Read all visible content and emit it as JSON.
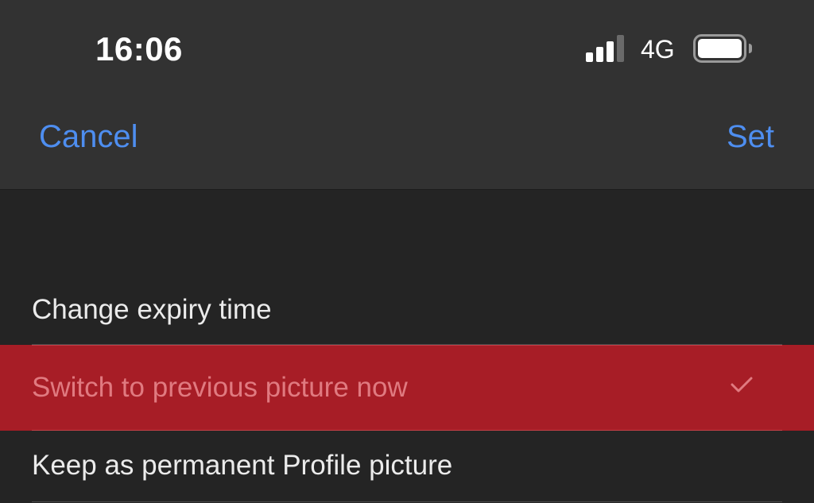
{
  "status_bar": {
    "time": "16:06",
    "network": "4G",
    "signal_icon": "signal-bars-icon",
    "battery_icon": "battery-icon"
  },
  "nav": {
    "cancel_label": "Cancel",
    "set_label": "Set"
  },
  "options": [
    {
      "label": "Change expiry time",
      "selected": false
    },
    {
      "label": "Switch to previous picture now",
      "selected": true,
      "icon": "checkmark-icon"
    },
    {
      "label": "Keep as permanent Profile picture",
      "selected": false
    }
  ],
  "colors": {
    "accent": "#4e8ef0",
    "highlight": "#a71d26",
    "highlight_text": "#e07a80",
    "background": "#242424",
    "bar": "#323232"
  }
}
